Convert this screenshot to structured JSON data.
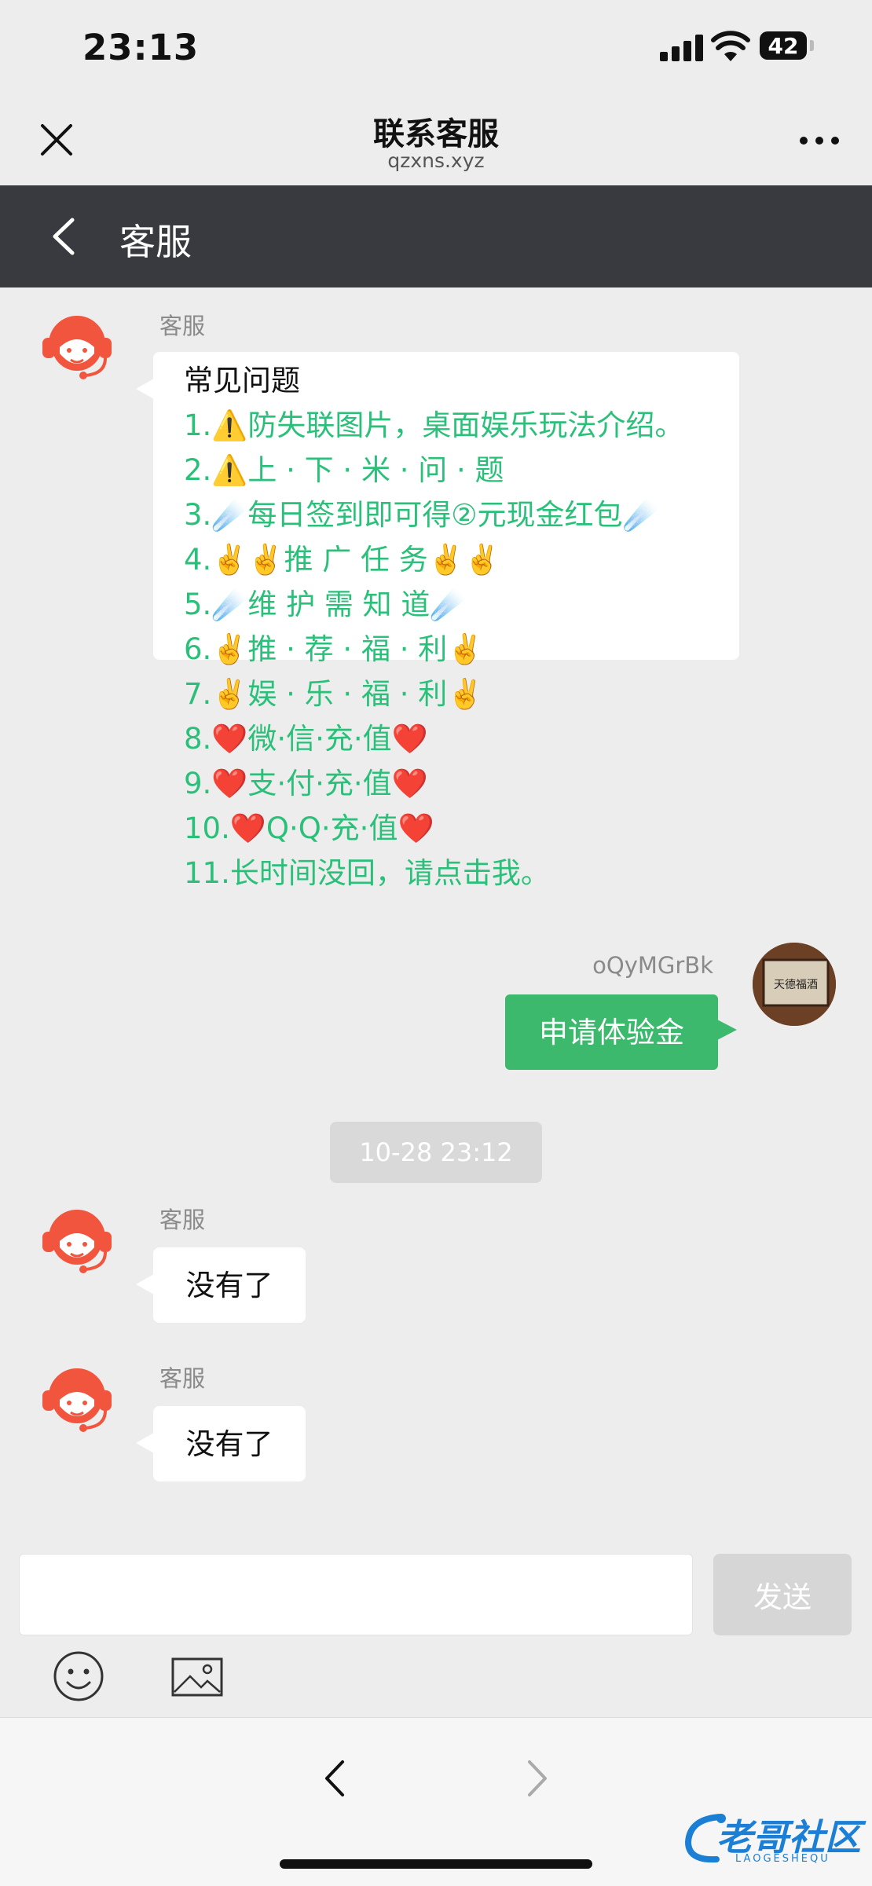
{
  "status_bar": {
    "time": "23:13",
    "battery": "42"
  },
  "web_header": {
    "title": "联系客服",
    "domain": "qzxns.xyz"
  },
  "page_header": {
    "title": "客服"
  },
  "messages": [
    {
      "sender": "客服",
      "faq_title": "常见问题",
      "faq_items": [
        "1.⚠️防失联图片，桌面娱乐玩法介绍。",
        "2.⚠️上 · 下 · 米 · 问 · 题",
        "3.☄️每日签到即可得②元现金红包☄️",
        "4.✌️✌️推 广 任 务✌️✌️",
        "5.☄️维 护 需 知 道☄️",
        "6.✌️推 · 荐 · 福 · 利✌️",
        "7.✌️娱 · 乐 · 福 · 利✌️",
        "8.❤️微·信·充·值❤️",
        "9.❤️支·付·充·值❤️",
        "10.❤️Q·Q·充·值❤️",
        "11.长时间没回，请点击我。"
      ]
    },
    {
      "sender": "oQyMGrBk",
      "text": "申请体验金"
    },
    {
      "timestamp": "10-28 23:12"
    },
    {
      "sender": "客服",
      "text": "没有了"
    },
    {
      "sender": "客服",
      "text": "没有了"
    }
  ],
  "input": {
    "value": "",
    "placeholder": "",
    "send_label": "发送"
  },
  "user_avatar_sign": "天德福酒",
  "watermark": {
    "text": "老哥社区",
    "sub": "LAOGESHEQU"
  },
  "colors": {
    "accent": "#3cb96c",
    "faq_text": "#2bc07a",
    "header_dark": "#393a3f",
    "agent_avatar": "#f2553d"
  },
  "icons": [
    "close-icon",
    "more-icon",
    "back-icon",
    "emoji-icon",
    "image-icon",
    "nav-back-icon",
    "nav-forward-icon"
  ]
}
